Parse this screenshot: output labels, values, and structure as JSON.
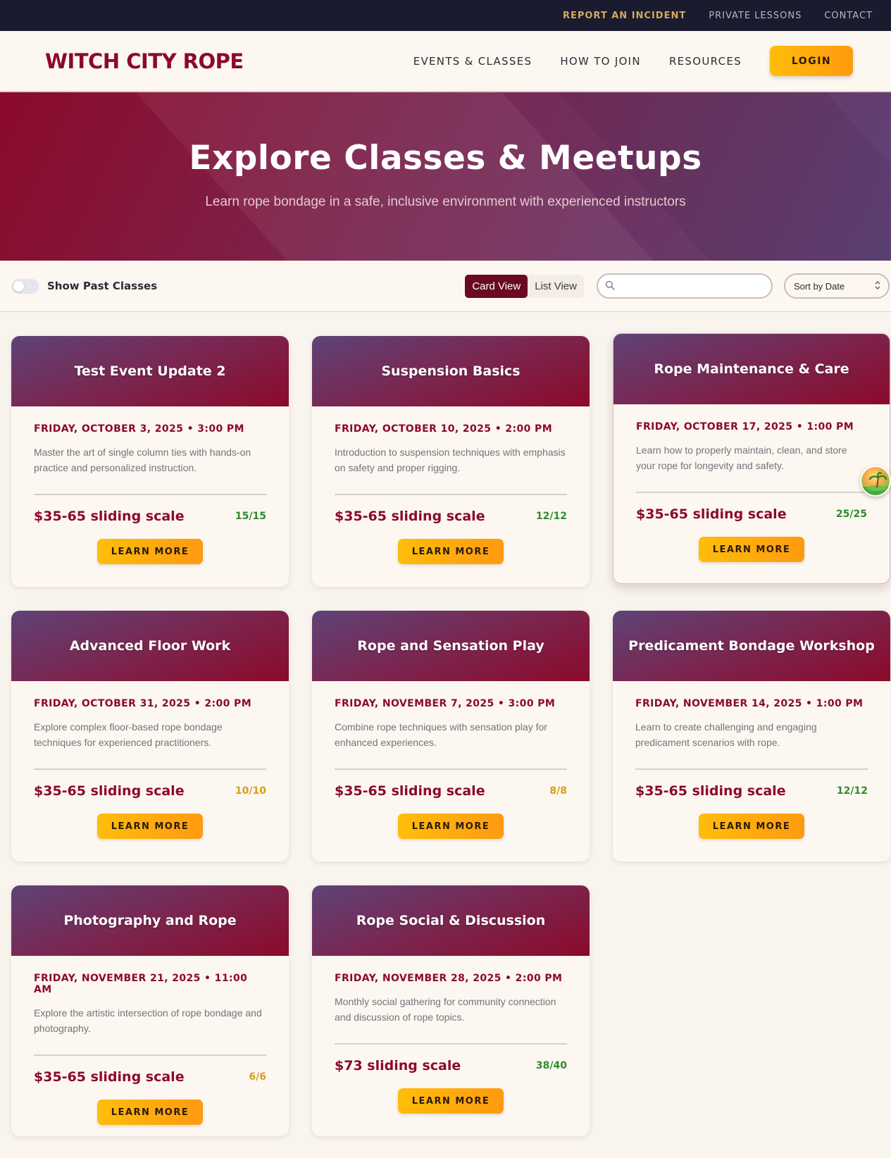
{
  "utility_nav": {
    "report": "REPORT AN INCIDENT",
    "lessons": "PRIVATE LESSONS",
    "contact": "CONTACT"
  },
  "header": {
    "logo": "WITCH CITY ROPE",
    "nav": [
      "EVENTS & CLASSES",
      "HOW TO JOIN",
      "RESOURCES"
    ],
    "login": "LOGIN"
  },
  "hero": {
    "title": "Explore Classes & Meetups",
    "subtitle": "Learn rope bondage in a safe, inclusive environment with experienced instructors"
  },
  "filters": {
    "show_past_label": "Show Past Classes",
    "show_past_on": false,
    "card_view": "Card View",
    "list_view": "List View",
    "active_view": "Card View",
    "search_value": "",
    "sort_selected": "Sort by Date"
  },
  "colors": {
    "primary": "#8b0a2a",
    "accent": "#ffb20c",
    "capacity_ok": "#2e8b2e",
    "capacity_warn": "#d4a017"
  },
  "events": [
    {
      "title": "Test Event Update 2",
      "date": "FRIDAY, OCTOBER 3, 2025 • 3:00 PM",
      "description": "Master the art of single column ties with hands-on practice and personalized instruction.",
      "price": "$35-65 sliding scale",
      "capacity": "15/15",
      "cta": "LEARN MORE"
    },
    {
      "title": "Suspension Basics",
      "date": "FRIDAY, OCTOBER 10, 2025 • 2:00 PM",
      "description": "Introduction to suspension techniques with emphasis on safety and proper rigging.",
      "price": "$35-65 sliding scale",
      "capacity": "12/12",
      "cta": "LEARN MORE"
    },
    {
      "title": "Rope Maintenance & Care",
      "date": "FRIDAY, OCTOBER 17, 2025 • 1:00 PM",
      "description": "Learn how to properly maintain, clean, and store your rope for longevity and safety.",
      "price": "$35-65 sliding scale",
      "capacity": "25/25",
      "cta": "LEARN MORE"
    },
    {
      "title": "Advanced Floor Work",
      "date": "FRIDAY, OCTOBER 31, 2025 • 2:00 PM",
      "description": "Explore complex floor-based rope bondage techniques for experienced practitioners.",
      "price": "$35-65 sliding scale",
      "capacity": "10/10",
      "cta": "LEARN MORE"
    },
    {
      "title": "Rope and Sensation Play",
      "date": "FRIDAY, NOVEMBER 7, 2025 • 3:00 PM",
      "description": "Combine rope techniques with sensation play for enhanced experiences.",
      "price": "$35-65 sliding scale",
      "capacity": "8/8",
      "cta": "LEARN MORE"
    },
    {
      "title": "Predicament Bondage Workshop",
      "date": "FRIDAY, NOVEMBER 14, 2025 • 1:00 PM",
      "description": "Learn to create challenging and engaging predicament scenarios with rope.",
      "price": "$35-65 sliding scale",
      "capacity": "12/12",
      "cta": "LEARN MORE"
    },
    {
      "title": "Photography and Rope",
      "date": "FRIDAY, NOVEMBER 21, 2025 • 11:00 AM",
      "description": "Explore the artistic intersection of rope bondage and photography.",
      "price": "$35-65 sliding scale",
      "capacity": "6/6",
      "cta": "LEARN MORE"
    },
    {
      "title": "Rope Social & Discussion",
      "date": "FRIDAY, NOVEMBER 28, 2025 • 2:00 PM",
      "description": "Monthly social gathering for community connection and discussion of rope topics.",
      "price": "$73 sliding scale",
      "capacity": "38/40",
      "cta": "LEARN MORE"
    }
  ]
}
